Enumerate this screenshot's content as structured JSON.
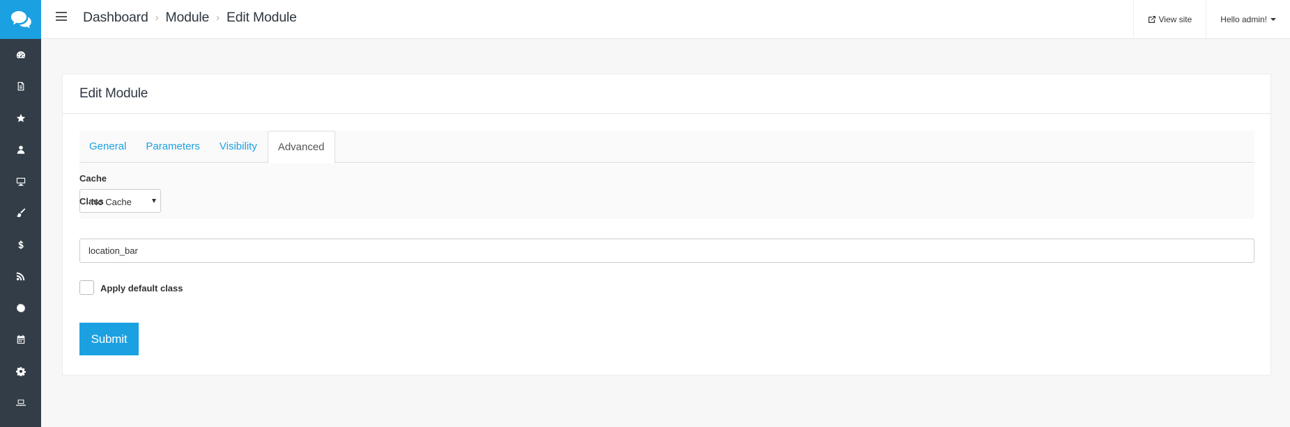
{
  "sidebar": {
    "logo_icon": "chat-bubbles-icon",
    "items": [
      {
        "icon": "dashboard-icon"
      },
      {
        "icon": "document-icon"
      },
      {
        "icon": "star-icon"
      },
      {
        "icon": "user-icon"
      },
      {
        "icon": "monitor-icon"
      },
      {
        "icon": "paintbrush-icon"
      },
      {
        "icon": "dollar-icon"
      },
      {
        "icon": "rss-icon"
      },
      {
        "icon": "cog-badge-icon"
      },
      {
        "icon": "calendar-icon"
      },
      {
        "icon": "gear-icon"
      },
      {
        "icon": "laptop-icon"
      }
    ]
  },
  "header": {
    "breadcrumb": [
      "Dashboard",
      "Module",
      "Edit Module"
    ],
    "view_site": "View site",
    "user_menu": "Hello admin!"
  },
  "card": {
    "title": "Edit Module",
    "tabs": [
      "General",
      "Parameters",
      "Visibility",
      "Advanced"
    ],
    "active_tab": "Advanced",
    "cache": {
      "label": "Cache",
      "selected": "No Cache"
    },
    "class_field": {
      "label": "Class",
      "value": "location_bar"
    },
    "apply_default": {
      "label": "Apply default class",
      "checked": false
    },
    "submit_label": "Submit"
  },
  "colors": {
    "accent": "#1ba1e2",
    "sidebar_bg": "#323d47",
    "page_bg": "#f7f7f7"
  }
}
